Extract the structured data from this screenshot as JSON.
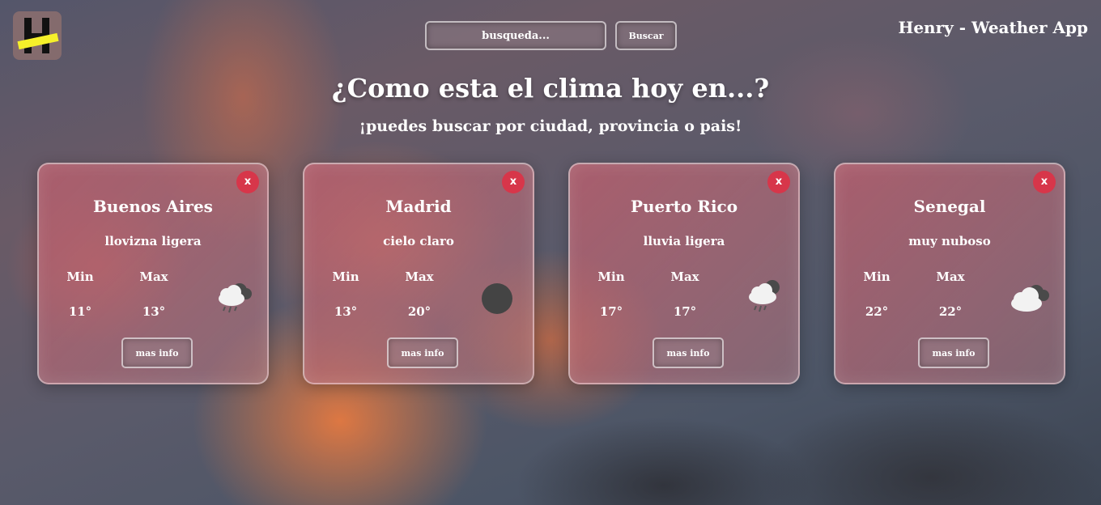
{
  "header": {
    "logo_icon": "henry-logo-icon",
    "search_placeholder": "busqueda...",
    "search_button_label": "Buscar",
    "app_title": "Henry - Weather App"
  },
  "main": {
    "headline": "¿Como esta el clima hoy en...?",
    "subheadline": "¡puedes buscar por ciudad, provincia o pais!"
  },
  "cards": [
    {
      "city": "Buenos Aires",
      "description": "llovizna ligera",
      "min_label": "Min",
      "max_label": "Max",
      "min": "11°",
      "max": "13°",
      "icon": "drizzle-icon",
      "close_label": "x",
      "more_label": "mas info"
    },
    {
      "city": "Madrid",
      "description": "cielo claro",
      "min_label": "Min",
      "max_label": "Max",
      "min": "13°",
      "max": "20°",
      "icon": "clear-night-icon",
      "close_label": "x",
      "more_label": "mas info"
    },
    {
      "city": "Puerto Rico",
      "description": "lluvia ligera",
      "min_label": "Min",
      "max_label": "Max",
      "min": "17°",
      "max": "17°",
      "icon": "light-rain-icon",
      "close_label": "x",
      "more_label": "mas info"
    },
    {
      "city": "Senegal",
      "description": "muy nuboso",
      "min_label": "Min",
      "max_label": "Max",
      "min": "22°",
      "max": "22°",
      "icon": "broken-clouds-icon",
      "close_label": "x",
      "more_label": "mas info"
    }
  ],
  "colors": {
    "close_button": "#d7364a",
    "logo_stripe": "#f6f02a",
    "text": "#ffffff"
  }
}
